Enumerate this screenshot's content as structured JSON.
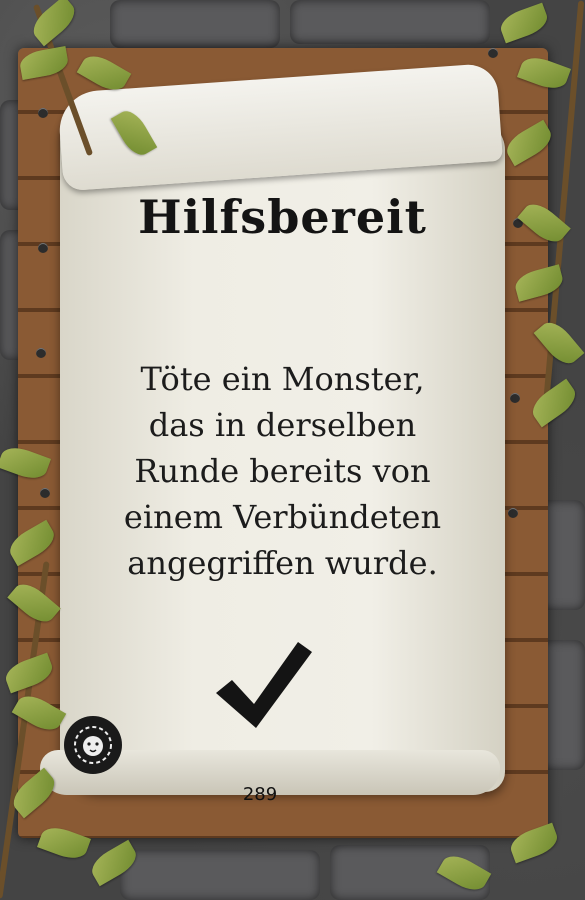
{
  "card": {
    "title": "Hilfsbereit",
    "text_lines": [
      "Töte ein Monster,",
      "das in derselben",
      "Runde bereits von",
      "einem Verbündeten",
      "angegriffen wurde."
    ],
    "number": "289",
    "icons": {
      "check": "checkmark-icon",
      "emblem": "lion-emblem-icon"
    },
    "colors": {
      "ink": "#141414",
      "parchment": "#efede4",
      "wood": "#8a5a34",
      "leaf": "#8ea343"
    }
  }
}
